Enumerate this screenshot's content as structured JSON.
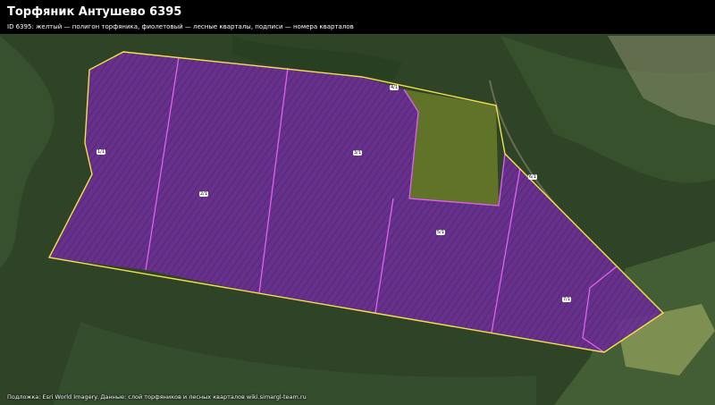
{
  "map": {
    "title": "Торфяник Антушево 6395",
    "legend_text": "ID 6395: желтый — полигон торфяника, фиолетовый — лесные кварталы, подписи — номера кварталов",
    "attribution": "Подложка: Esri World Imagery. Данные: слой торфяников и лесных кварталов wiki.simargl-team.ru",
    "colors": {
      "peat_polygon": "#f3e24a",
      "quarter_fill": "#6a2f93",
      "quarter_border": "#e062f0",
      "forest": "#2f4426",
      "field": "#7e8f52"
    },
    "quarter_labels": [
      "1/1",
      "2/1",
      "3/1",
      "4/1",
      "5/1",
      "6/1",
      "7/1"
    ]
  }
}
